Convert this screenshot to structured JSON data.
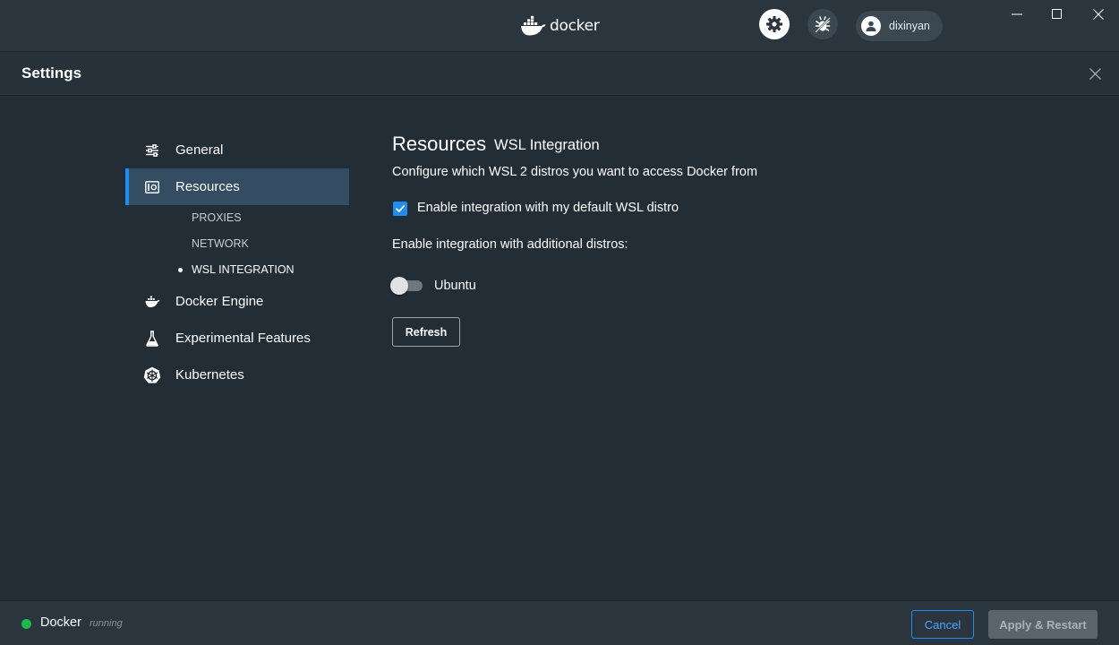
{
  "titlebar": {
    "brand": "docker",
    "user": {
      "name": "dixinyan",
      "icon": "user-icon"
    },
    "icons": {
      "settings": "gear-icon",
      "troubleshoot": "bug-icon",
      "minimize": "minimize-icon",
      "maximize": "maximize-icon",
      "close": "close-icon"
    }
  },
  "settings": {
    "title": "Settings",
    "close_icon": "close-icon"
  },
  "sidebar": {
    "items": [
      {
        "label": "General",
        "icon": "sliders-icon"
      },
      {
        "label": "Resources",
        "icon": "resources-icon",
        "active": true
      },
      {
        "label": "Docker Engine",
        "icon": "whale-icon"
      },
      {
        "label": "Experimental Features",
        "icon": "flask-icon"
      },
      {
        "label": "Kubernetes",
        "icon": "helm-wheel-icon"
      }
    ],
    "subitems": [
      {
        "label": "PROXIES"
      },
      {
        "label": "NETWORK"
      },
      {
        "label": "WSL INTEGRATION",
        "current": true
      }
    ]
  },
  "content": {
    "section": "Resources",
    "subsection": "WSL Integration",
    "description": "Configure which WSL 2 distros you want to access Docker from",
    "default_integration": {
      "label": "Enable integration with my default WSL distro",
      "checked": true
    },
    "additional_label": "Enable integration with additional distros:",
    "distros": [
      {
        "name": "Ubuntu",
        "enabled": false
      }
    ],
    "refresh_label": "Refresh"
  },
  "footer": {
    "app_name": "Docker",
    "status": "running",
    "status_color": "#21b84b",
    "cancel_label": "Cancel",
    "apply_label": "Apply & Restart"
  },
  "colors": {
    "accent": "#1d8df0",
    "background": "#232d36",
    "active_nav": "#344d62"
  }
}
